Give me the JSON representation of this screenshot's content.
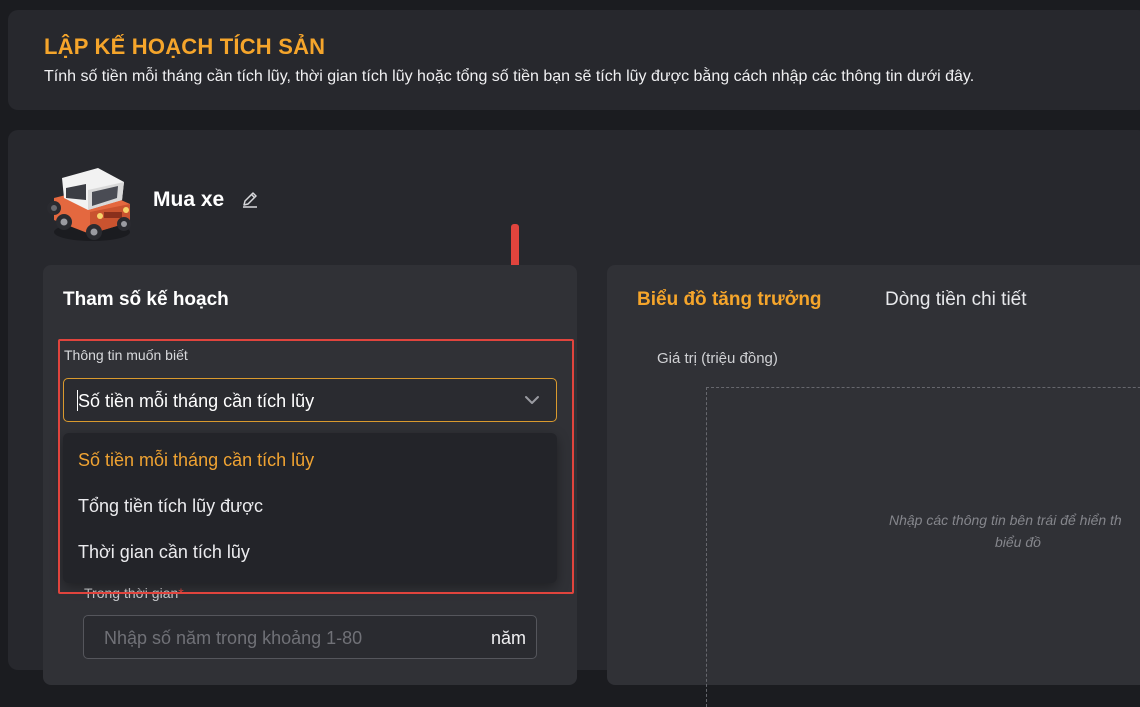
{
  "header": {
    "title": "LẬP KẾ HOẠCH TÍCH SẢN",
    "description": "Tính số tiền mỗi tháng cần tích lũy, thời gian tích lũy hoặc tổng số tiền bạn sẽ tích lũy được bằng cách nhập các thông tin dưới đây."
  },
  "goal": {
    "name": "Mua xe",
    "image_icon": "car-icon",
    "edit_icon": "pencil-icon"
  },
  "params": {
    "title": "Tham số kế hoạch",
    "info_label": "Thông tin muốn biết",
    "selected_value": "Số tiền mỗi tháng cần tích lũy",
    "options": [
      "Số tiền mỗi tháng cần tích lũy",
      "Tổng tiền tích lũy được",
      "Thời gian cần tích lũy"
    ],
    "period_label": "Trong thời gian",
    "period_required_mark": "*",
    "period_placeholder": "Nhập số năm trong khoảng 1-80",
    "period_unit": "năm"
  },
  "chart": {
    "tabs": [
      "Biểu đồ tăng trưởng",
      "Dòng tiền chi tiết"
    ],
    "active_tab": "Biểu đồ tăng trưởng",
    "y_axis_label": "Giá trị (triệu đồng)",
    "empty_message_line1": "Nhập các thông tin bên trái để hiển th",
    "empty_message_line2": "biểu đồ"
  },
  "colors": {
    "accent": "#f5a52b",
    "annotation_red": "#e0443d",
    "panel_bg": "#303136",
    "page_bg": "#1b1c20"
  }
}
